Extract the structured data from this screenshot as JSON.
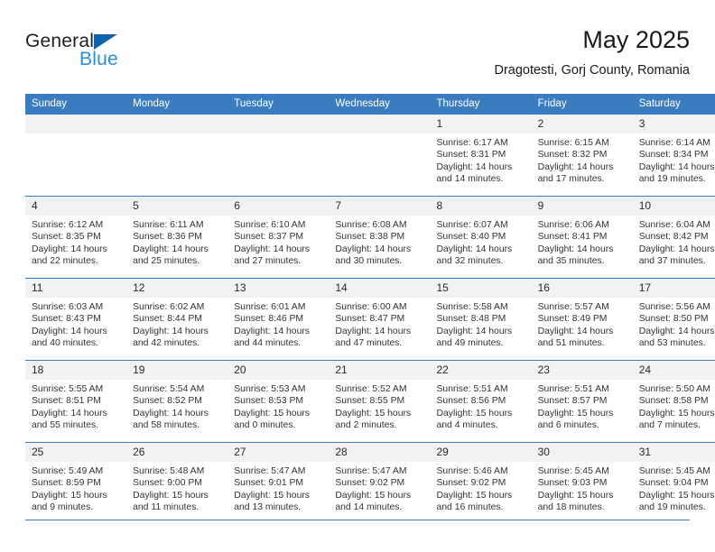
{
  "brand": {
    "name_top": "General",
    "name_bottom": "Blue",
    "triangle_icon": "blue-triangle-icon",
    "color_dark": "#231f20",
    "color_blue": "#2b8fd4",
    "color_triangle": "#0f63ae"
  },
  "header": {
    "title": "May 2025",
    "subtitle": "Dragotesti, Gorj County, Romania"
  },
  "theme": {
    "header_row_bg": "#3a7cbf",
    "day_number_bg": "#f2f2f2",
    "rule_color": "#3a7cbf",
    "text_color": "#333333"
  },
  "weekday_headers": [
    "Sunday",
    "Monday",
    "Tuesday",
    "Wednesday",
    "Thursday",
    "Friday",
    "Saturday"
  ],
  "weeks": [
    [
      {
        "day": "",
        "sunrise": "",
        "sunset": "",
        "daylight_line1": "",
        "daylight_line2": ""
      },
      {
        "day": "",
        "sunrise": "",
        "sunset": "",
        "daylight_line1": "",
        "daylight_line2": ""
      },
      {
        "day": "",
        "sunrise": "",
        "sunset": "",
        "daylight_line1": "",
        "daylight_line2": ""
      },
      {
        "day": "",
        "sunrise": "",
        "sunset": "",
        "daylight_line1": "",
        "daylight_line2": ""
      },
      {
        "day": "1",
        "sunrise": "Sunrise: 6:17 AM",
        "sunset": "Sunset: 8:31 PM",
        "daylight_line1": "Daylight: 14 hours",
        "daylight_line2": "and 14 minutes."
      },
      {
        "day": "2",
        "sunrise": "Sunrise: 6:15 AM",
        "sunset": "Sunset: 8:32 PM",
        "daylight_line1": "Daylight: 14 hours",
        "daylight_line2": "and 17 minutes."
      },
      {
        "day": "3",
        "sunrise": "Sunrise: 6:14 AM",
        "sunset": "Sunset: 8:34 PM",
        "daylight_line1": "Daylight: 14 hours",
        "daylight_line2": "and 19 minutes."
      }
    ],
    [
      {
        "day": "4",
        "sunrise": "Sunrise: 6:12 AM",
        "sunset": "Sunset: 8:35 PM",
        "daylight_line1": "Daylight: 14 hours",
        "daylight_line2": "and 22 minutes."
      },
      {
        "day": "5",
        "sunrise": "Sunrise: 6:11 AM",
        "sunset": "Sunset: 8:36 PM",
        "daylight_line1": "Daylight: 14 hours",
        "daylight_line2": "and 25 minutes."
      },
      {
        "day": "6",
        "sunrise": "Sunrise: 6:10 AM",
        "sunset": "Sunset: 8:37 PM",
        "daylight_line1": "Daylight: 14 hours",
        "daylight_line2": "and 27 minutes."
      },
      {
        "day": "7",
        "sunrise": "Sunrise: 6:08 AM",
        "sunset": "Sunset: 8:38 PM",
        "daylight_line1": "Daylight: 14 hours",
        "daylight_line2": "and 30 minutes."
      },
      {
        "day": "8",
        "sunrise": "Sunrise: 6:07 AM",
        "sunset": "Sunset: 8:40 PM",
        "daylight_line1": "Daylight: 14 hours",
        "daylight_line2": "and 32 minutes."
      },
      {
        "day": "9",
        "sunrise": "Sunrise: 6:06 AM",
        "sunset": "Sunset: 8:41 PM",
        "daylight_line1": "Daylight: 14 hours",
        "daylight_line2": "and 35 minutes."
      },
      {
        "day": "10",
        "sunrise": "Sunrise: 6:04 AM",
        "sunset": "Sunset: 8:42 PM",
        "daylight_line1": "Daylight: 14 hours",
        "daylight_line2": "and 37 minutes."
      }
    ],
    [
      {
        "day": "11",
        "sunrise": "Sunrise: 6:03 AM",
        "sunset": "Sunset: 8:43 PM",
        "daylight_line1": "Daylight: 14 hours",
        "daylight_line2": "and 40 minutes."
      },
      {
        "day": "12",
        "sunrise": "Sunrise: 6:02 AM",
        "sunset": "Sunset: 8:44 PM",
        "daylight_line1": "Daylight: 14 hours",
        "daylight_line2": "and 42 minutes."
      },
      {
        "day": "13",
        "sunrise": "Sunrise: 6:01 AM",
        "sunset": "Sunset: 8:46 PM",
        "daylight_line1": "Daylight: 14 hours",
        "daylight_line2": "and 44 minutes."
      },
      {
        "day": "14",
        "sunrise": "Sunrise: 6:00 AM",
        "sunset": "Sunset: 8:47 PM",
        "daylight_line1": "Daylight: 14 hours",
        "daylight_line2": "and 47 minutes."
      },
      {
        "day": "15",
        "sunrise": "Sunrise: 5:58 AM",
        "sunset": "Sunset: 8:48 PM",
        "daylight_line1": "Daylight: 14 hours",
        "daylight_line2": "and 49 minutes."
      },
      {
        "day": "16",
        "sunrise": "Sunrise: 5:57 AM",
        "sunset": "Sunset: 8:49 PM",
        "daylight_line1": "Daylight: 14 hours",
        "daylight_line2": "and 51 minutes."
      },
      {
        "day": "17",
        "sunrise": "Sunrise: 5:56 AM",
        "sunset": "Sunset: 8:50 PM",
        "daylight_line1": "Daylight: 14 hours",
        "daylight_line2": "and 53 minutes."
      }
    ],
    [
      {
        "day": "18",
        "sunrise": "Sunrise: 5:55 AM",
        "sunset": "Sunset: 8:51 PM",
        "daylight_line1": "Daylight: 14 hours",
        "daylight_line2": "and 55 minutes."
      },
      {
        "day": "19",
        "sunrise": "Sunrise: 5:54 AM",
        "sunset": "Sunset: 8:52 PM",
        "daylight_line1": "Daylight: 14 hours",
        "daylight_line2": "and 58 minutes."
      },
      {
        "day": "20",
        "sunrise": "Sunrise: 5:53 AM",
        "sunset": "Sunset: 8:53 PM",
        "daylight_line1": "Daylight: 15 hours",
        "daylight_line2": "and 0 minutes."
      },
      {
        "day": "21",
        "sunrise": "Sunrise: 5:52 AM",
        "sunset": "Sunset: 8:55 PM",
        "daylight_line1": "Daylight: 15 hours",
        "daylight_line2": "and 2 minutes."
      },
      {
        "day": "22",
        "sunrise": "Sunrise: 5:51 AM",
        "sunset": "Sunset: 8:56 PM",
        "daylight_line1": "Daylight: 15 hours",
        "daylight_line2": "and 4 minutes."
      },
      {
        "day": "23",
        "sunrise": "Sunrise: 5:51 AM",
        "sunset": "Sunset: 8:57 PM",
        "daylight_line1": "Daylight: 15 hours",
        "daylight_line2": "and 6 minutes."
      },
      {
        "day": "24",
        "sunrise": "Sunrise: 5:50 AM",
        "sunset": "Sunset: 8:58 PM",
        "daylight_line1": "Daylight: 15 hours",
        "daylight_line2": "and 7 minutes."
      }
    ],
    [
      {
        "day": "25",
        "sunrise": "Sunrise: 5:49 AM",
        "sunset": "Sunset: 8:59 PM",
        "daylight_line1": "Daylight: 15 hours",
        "daylight_line2": "and 9 minutes."
      },
      {
        "day": "26",
        "sunrise": "Sunrise: 5:48 AM",
        "sunset": "Sunset: 9:00 PM",
        "daylight_line1": "Daylight: 15 hours",
        "daylight_line2": "and 11 minutes."
      },
      {
        "day": "27",
        "sunrise": "Sunrise: 5:47 AM",
        "sunset": "Sunset: 9:01 PM",
        "daylight_line1": "Daylight: 15 hours",
        "daylight_line2": "and 13 minutes."
      },
      {
        "day": "28",
        "sunrise": "Sunrise: 5:47 AM",
        "sunset": "Sunset: 9:02 PM",
        "daylight_line1": "Daylight: 15 hours",
        "daylight_line2": "and 14 minutes."
      },
      {
        "day": "29",
        "sunrise": "Sunrise: 5:46 AM",
        "sunset": "Sunset: 9:02 PM",
        "daylight_line1": "Daylight: 15 hours",
        "daylight_line2": "and 16 minutes."
      },
      {
        "day": "30",
        "sunrise": "Sunrise: 5:45 AM",
        "sunset": "Sunset: 9:03 PM",
        "daylight_line1": "Daylight: 15 hours",
        "daylight_line2": "and 18 minutes."
      },
      {
        "day": "31",
        "sunrise": "Sunrise: 5:45 AM",
        "sunset": "Sunset: 9:04 PM",
        "daylight_line1": "Daylight: 15 hours",
        "daylight_line2": "and 19 minutes."
      }
    ]
  ]
}
